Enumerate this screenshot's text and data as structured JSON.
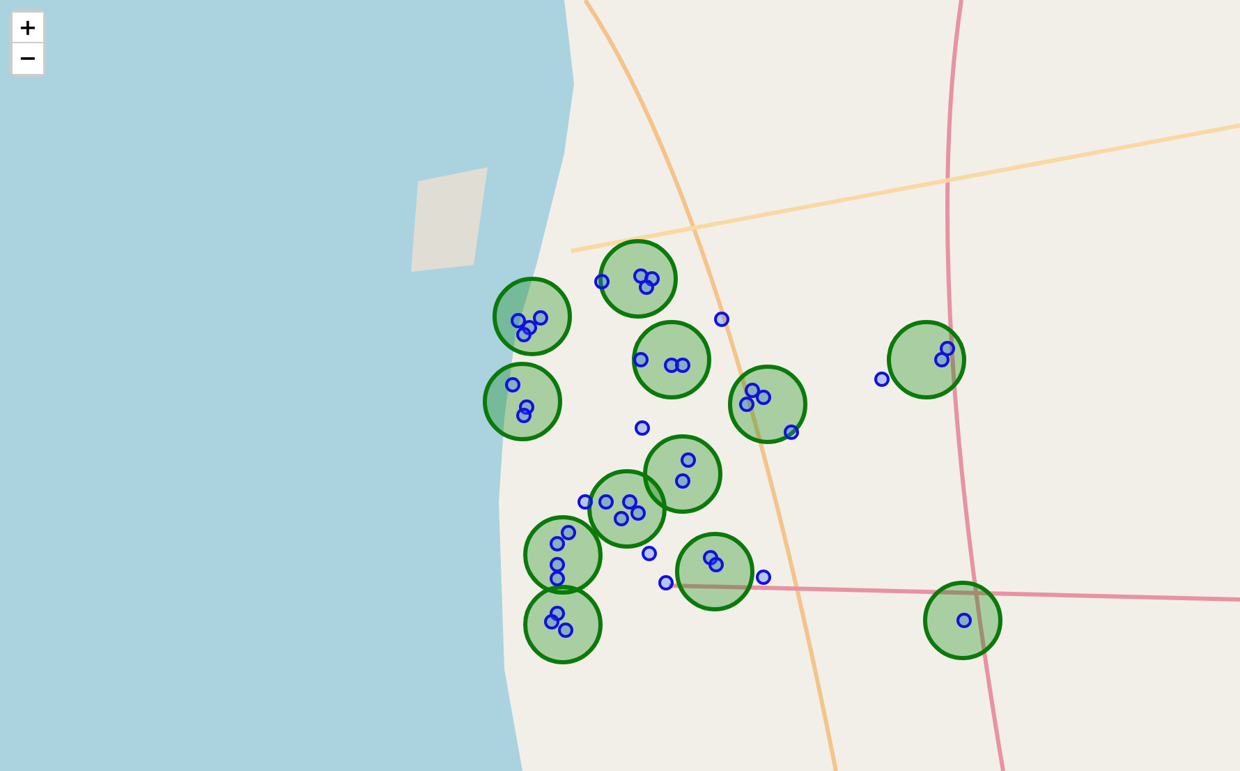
{
  "zoom_controls": {
    "zoom_in": "+",
    "zoom_out": "−"
  }
}
